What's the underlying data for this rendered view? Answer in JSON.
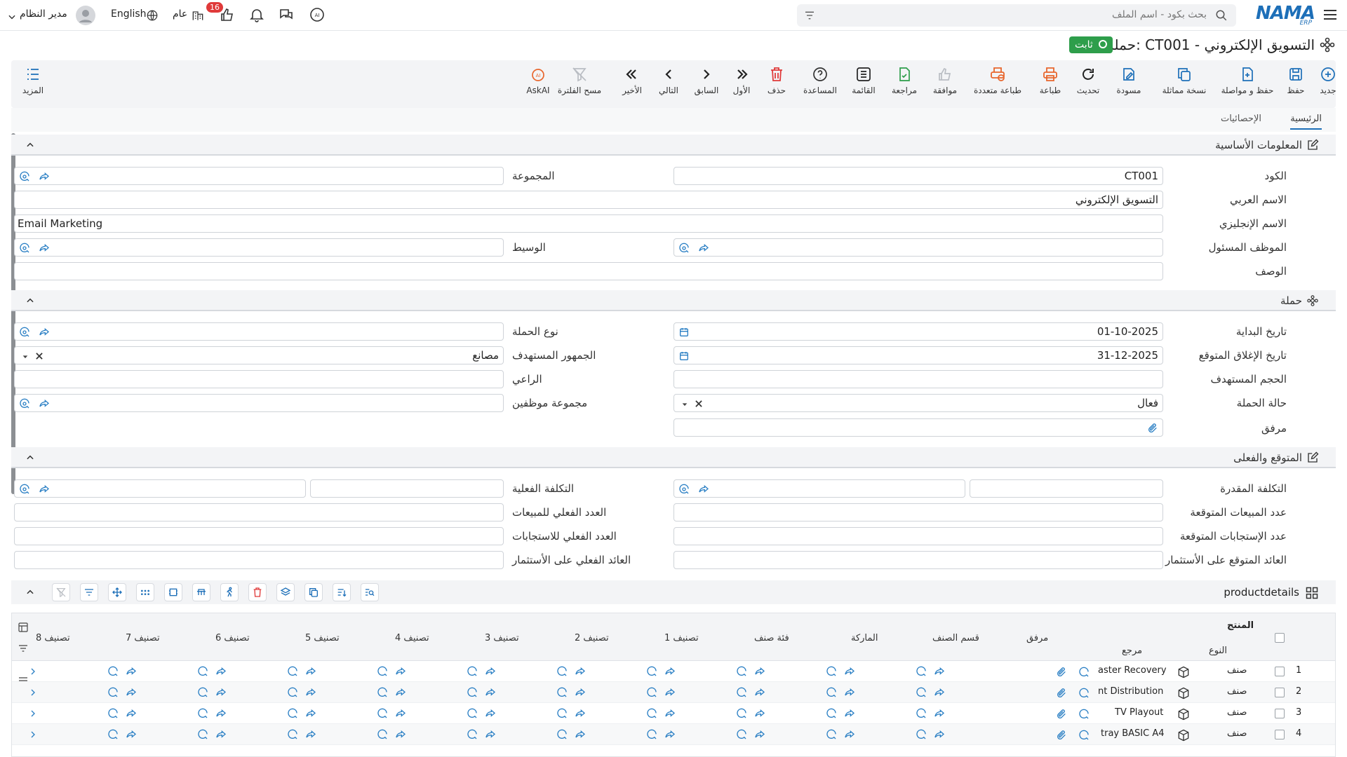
{
  "topbar": {
    "user_name": "مدير النظام",
    "language": "English",
    "workspace": "عام",
    "notif_count": "16",
    "search_placeholder": "بحث بكود - اسم الملف",
    "logo": "NAMA",
    "logo_sub": "ERP"
  },
  "page": {
    "title": "حملة: CT001 - التسويق الإلكتروني",
    "status": "ثابت",
    "status_color": "#2e9e4b"
  },
  "toolbar": {
    "items": [
      {
        "label": "جديد",
        "icon": "plus-circle-icon"
      },
      {
        "label": "حفظ",
        "icon": "save-icon"
      },
      {
        "label": "حفظ و مواصلة",
        "icon": "save-continue-icon"
      },
      {
        "label": "نسخة مماثلة",
        "icon": "copy-icon"
      },
      {
        "label": "مسودة",
        "icon": "draft-icon"
      },
      {
        "label": "تحديث",
        "icon": "refresh-icon"
      },
      {
        "label": "طباعة",
        "icon": "print-icon"
      },
      {
        "label": "طباعة متعددة",
        "icon": "multi-print-icon"
      },
      {
        "label": "موافقة",
        "icon": "thumb-up-icon"
      },
      {
        "label": "مراجعة",
        "icon": "review-icon"
      },
      {
        "label": "القائمة",
        "icon": "list-icon"
      },
      {
        "label": "المساعدة",
        "icon": "help-icon"
      },
      {
        "label": "حذف",
        "icon": "trash-icon"
      },
      {
        "label": "الأول",
        "icon": "first-icon"
      },
      {
        "label": "السابق",
        "icon": "prev-icon"
      },
      {
        "label": "التالي",
        "icon": "next-icon"
      },
      {
        "label": "الأخير",
        "icon": "last-icon"
      },
      {
        "label": "مسح الفلترة",
        "icon": "clear-filter-icon"
      },
      {
        "label": "AskAI",
        "icon": "ai-icon"
      }
    ],
    "more": "المزيد"
  },
  "tabs": [
    "الرئيسية",
    "الإحصائيات"
  ],
  "sections": {
    "basic": "المعلومات الأساسية",
    "campaign": "حملة",
    "expected": "المتوقع والفعلى"
  },
  "fields": {
    "code_label": "الكود",
    "code": "CT001",
    "group_label": "المجموعة",
    "arabic_name_label": "الاسم العربي",
    "arabic_name": "التسويق الإلكتروني",
    "english_name_label": "الاسم الإنجليزي",
    "english_name": "Email Marketing",
    "employee_label": "الموظف المسئول",
    "broker_label": "الوسيط",
    "description_label": "الوصف",
    "start_date_label": "تاريخ البداية",
    "start_date": "01-10-2025",
    "campaign_type_label": "نوع الحملة",
    "close_date_label": "تاريخ الإغلاق المتوقع",
    "close_date": "31-12-2025",
    "audience_label": "الجمهور المستهدف",
    "audience": "مصانع",
    "target_size_label": "الحجم المستهدف",
    "sponsor_label": "الراعي",
    "status_label": "حالة الحملة",
    "status": "فعال",
    "employee_group_label": "مجموعة موظفين",
    "attachment_label": "مرفق",
    "est_cost_label": "التكلفة المقدرة",
    "actual_cost_label": "التكلفة الفعلية",
    "exp_sales_label": "عدد المبيعات المتوقعة",
    "act_sales_label": "العدد الفعلي للمبيعات",
    "exp_resp_label": "عدد الإستجابات المتوقعة",
    "act_resp_label": "العدد الفعلي للاستجابات",
    "exp_roi_label": "العائد المتوقع على الأستثمار",
    "act_roi_label": "العائد الفعلي على الأستثمار"
  },
  "grid": {
    "title": "productdetails",
    "group_header": "المنتج",
    "columns": [
      "النوع",
      "مرجع",
      "مرفق",
      "قسم الصنف",
      "الماركة",
      "فئة صنف",
      "تصنيف 1",
      "تصنيف 2",
      "تصنيف 3",
      "تصنيف 4",
      "تصنيف 5",
      "تصنيف 6",
      "تصنيف 7",
      "تصنيف 8"
    ],
    "rows": [
      {
        "n": "1",
        "type": "صنف",
        "ref": "aster Recovery"
      },
      {
        "n": "2",
        "type": "صنف",
        "ref": "nt Distribution"
      },
      {
        "n": "3",
        "type": "صنف",
        "ref": "TV Playout"
      },
      {
        "n": "4",
        "type": "صنف",
        "ref": "tray BASIC A4"
      }
    ]
  },
  "colors": {
    "accent": "#1d6fb8",
    "link_icon": "#2a7fc4",
    "danger": "#e03a3a",
    "print": "#e8662d"
  }
}
